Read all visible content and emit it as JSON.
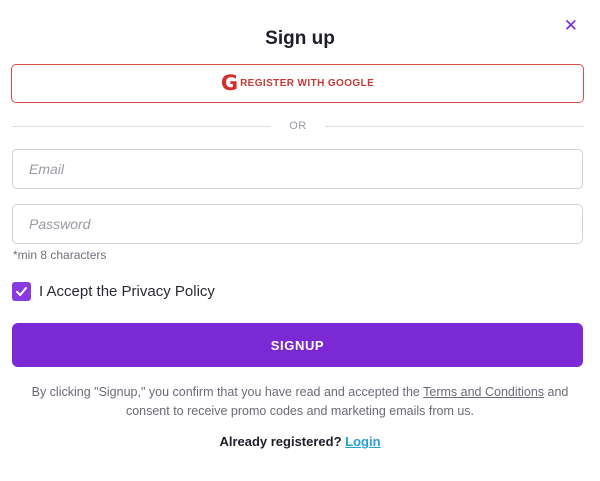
{
  "modal": {
    "title": "Sign up",
    "close_icon": "close-icon"
  },
  "google": {
    "icon_letter": "G",
    "label": "REGISTER WITH GOOGLE"
  },
  "divider": {
    "text": "OR"
  },
  "form": {
    "email_placeholder": "Email",
    "password_placeholder": "Password",
    "password_hint": "*min 8 characters",
    "privacy_label": "I Accept the Privacy Policy",
    "privacy_checked": true,
    "submit_label": "SIGNUP"
  },
  "legal": {
    "prefix": "By clicking \"Signup,\" you confirm that you have read and accepted the ",
    "terms_link": "Terms and Conditions",
    "suffix": " and consent to receive promo codes and marketing emails from us."
  },
  "footer": {
    "prompt": "Already registered?",
    "login_link": "Login"
  },
  "colors": {
    "accent": "#7a29d4",
    "google_red": "#d22f2f",
    "link_blue": "#2a9fd6"
  }
}
